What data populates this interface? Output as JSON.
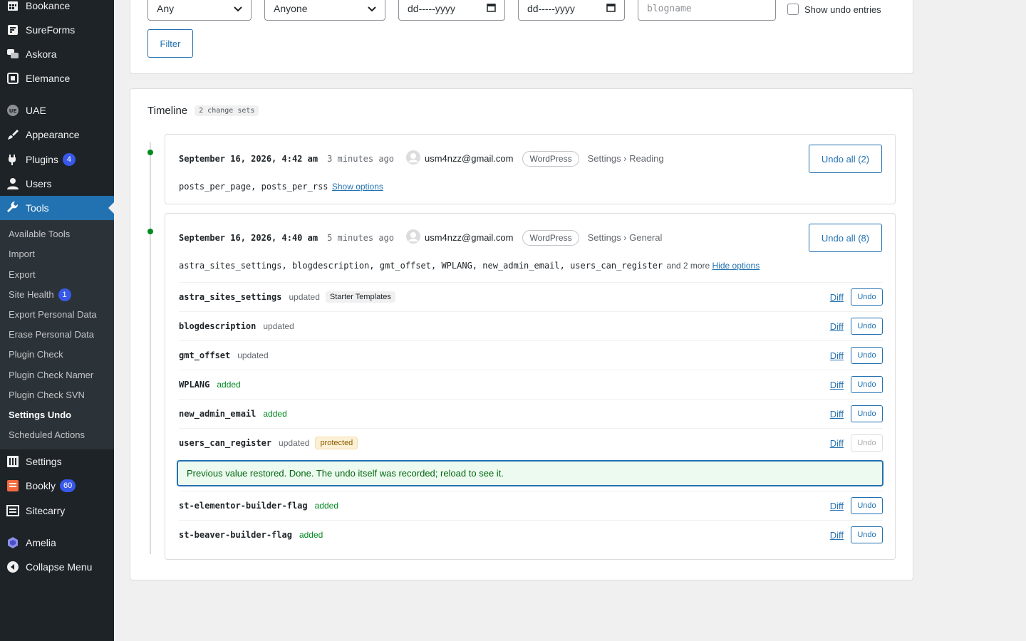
{
  "sidebar": {
    "top_items": [
      {
        "label": "Bookance",
        "icon": "calendar-grid-icon"
      },
      {
        "label": "SureForms",
        "icon": "sureforms-icon"
      },
      {
        "label": "Askora",
        "icon": "chat-bubbles-icon"
      },
      {
        "label": "Elemance",
        "icon": "elemance-icon"
      }
    ],
    "uae": {
      "label": "UAE",
      "icon": "uae-icon"
    },
    "appearance": {
      "label": "Appearance",
      "icon": "paintbrush-icon"
    },
    "plugins": {
      "label": "Plugins",
      "badge": "4",
      "icon": "plug-icon"
    },
    "users": {
      "label": "Users",
      "icon": "user-icon"
    },
    "tools": {
      "label": "Tools",
      "icon": "wrench-icon"
    },
    "submenu": [
      {
        "label": "Available Tools"
      },
      {
        "label": "Import"
      },
      {
        "label": "Export"
      },
      {
        "label": "Site Health",
        "badge": "1"
      },
      {
        "label": "Export Personal Data"
      },
      {
        "label": "Erase Personal Data"
      },
      {
        "label": "Plugin Check"
      },
      {
        "label": "Plugin Check Namer"
      },
      {
        "label": "Plugin Check SVN"
      },
      {
        "label": "Settings Undo"
      },
      {
        "label": "Scheduled Actions"
      }
    ],
    "settings": {
      "label": "Settings",
      "icon": "sliders-icon"
    },
    "bookly": {
      "label": "Bookly",
      "badge": "60",
      "icon": "bookly-icon"
    },
    "sitecarry": {
      "label": "Sitecarry",
      "icon": "sitecarry-icon"
    },
    "amelia": {
      "label": "Amelia",
      "icon": "amelia-icon"
    },
    "collapse": {
      "label": "Collapse Menu",
      "icon": "collapse-arrow-icon"
    }
  },
  "filters": {
    "source_select": "Any",
    "user_select": "Anyone",
    "date_from_placeholder": "dd-----yyyy",
    "date_to_placeholder": "dd-----yyyy",
    "option_placeholder": "blogname",
    "show_undo_label": "Show undo entries",
    "filter_button": "Filter"
  },
  "timeline": {
    "title": "Timeline",
    "count_badge": "2 change sets",
    "changesets": [
      {
        "date": "September 16, 2026, 4:42 am",
        "ago": "3 minutes ago",
        "user": "usm4nzz@gmail.com",
        "source": "WordPress",
        "screen": "Settings › Reading",
        "undo_all": "Undo all (2)",
        "options_list": "posts_per_page, posts_per_rss",
        "toggle_link": "Show options"
      },
      {
        "date": "September 16, 2026, 4:40 am",
        "ago": "5 minutes ago",
        "user": "usm4nzz@gmail.com",
        "source": "WordPress",
        "screen": "Settings › General",
        "undo_all": "Undo all (8)",
        "options_list": "astra_sites_settings, blogdescription, gmt_offset, WPLANG, new_admin_email, users_can_register",
        "more_text": "and 2 more",
        "toggle_link": "Hide options",
        "rows": [
          {
            "name": "astra_sites_settings",
            "status": "updated",
            "tag": "Starter Templates",
            "diff": "Diff",
            "undo": "Undo"
          },
          {
            "name": "blogdescription",
            "status": "updated",
            "diff": "Diff",
            "undo": "Undo"
          },
          {
            "name": "gmt_offset",
            "status": "updated",
            "diff": "Diff",
            "undo": "Undo"
          },
          {
            "name": "WPLANG",
            "status": "added",
            "diff": "Diff",
            "undo": "Undo"
          },
          {
            "name": "new_admin_email",
            "status": "added",
            "diff": "Diff",
            "undo": "Undo"
          },
          {
            "name": "users_can_register",
            "status": "updated",
            "tag": "protected",
            "diff": "Diff",
            "undo": "Undo"
          },
          {
            "name": "st-elementor-builder-flag",
            "status": "added",
            "diff": "Diff",
            "undo": "Undo"
          },
          {
            "name": "st-beaver-builder-flag",
            "status": "added",
            "diff": "Diff",
            "undo": "Undo"
          }
        ],
        "notice": "Previous value restored. Done. The undo itself was recorded; reload to see it."
      }
    ]
  },
  "colors": {
    "accent": "#2271b1",
    "sidebar_bg": "#1d2327",
    "success": "#008a20"
  }
}
